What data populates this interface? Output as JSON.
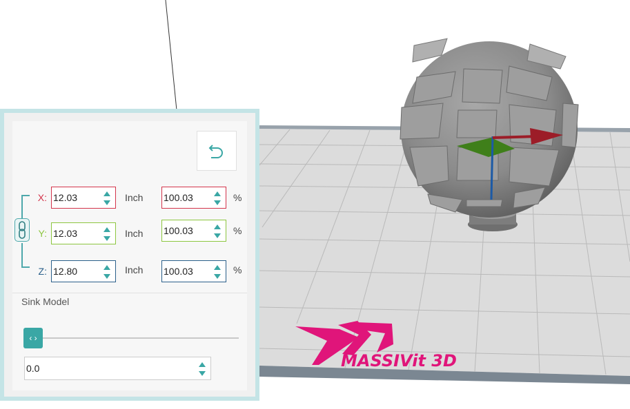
{
  "colors": {
    "accent": "#3aa7a5",
    "x_axis": "#d3334a",
    "y_axis": "#8cc63f",
    "z_axis": "#2a5f8a",
    "panel_border": "#c4e4e6",
    "brand_magenta": "#e0157a"
  },
  "scene": {
    "logo_text": "MASSIVit 3D"
  },
  "panel": {
    "reset_icon": "undo-icon",
    "link_icon": "chain-link-icon",
    "rows": [
      {
        "axis": "X:",
        "value": "12.03",
        "unit": "Inch",
        "percent": "100.03",
        "pct_sign": "%"
      },
      {
        "axis": "Y:",
        "value": "12.03",
        "unit": "Inch",
        "percent": "100.03",
        "pct_sign": "%"
      },
      {
        "axis": "Z:",
        "value": "12.80",
        "unit": "Inch",
        "percent": "100.03",
        "pct_sign": "%"
      }
    ],
    "sink": {
      "title": "Sink Model",
      "slider_level": 0,
      "handle_glyph": "‹ ›",
      "value": "0.0"
    }
  }
}
